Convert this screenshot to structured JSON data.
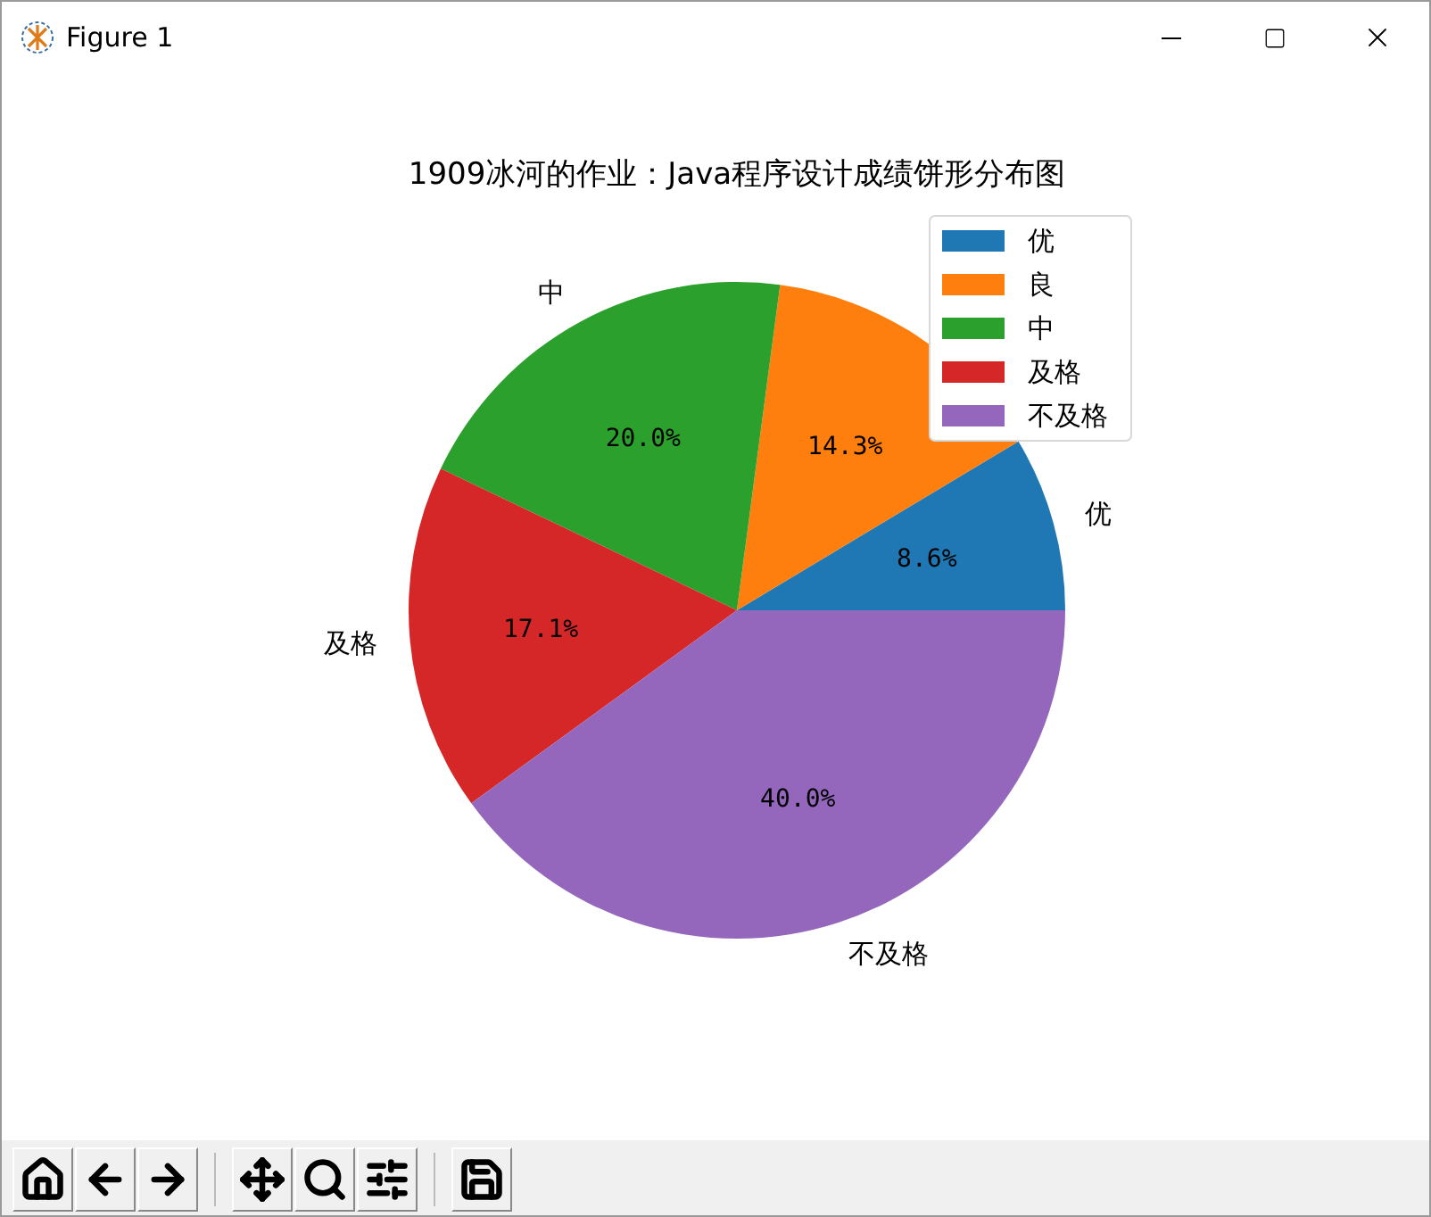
{
  "window": {
    "title": "Figure 1"
  },
  "figure": {
    "chart_data": {
      "type": "pie",
      "title": "1909冰河的作业：Java程序设计成绩饼形分布图",
      "categories": [
        "优",
        "良",
        "中",
        "及格",
        "不及格"
      ],
      "series": [
        {
          "values": [
            8.6,
            14.3,
            20.0,
            17.1,
            40.0
          ]
        }
      ],
      "colors": [
        "#1f77b4",
        "#ff7f0e",
        "#2ca02c",
        "#d62728",
        "#9467bd"
      ],
      "value_labels": [
        "8.6%",
        "14.3%",
        "20.0%",
        "17.1%",
        "40.0%"
      ],
      "legend": true
    }
  },
  "toolbar": [
    {
      "kind": "home"
    },
    {
      "kind": "back"
    },
    {
      "kind": "forward"
    },
    {
      "kind": "separator"
    },
    {
      "kind": "pan"
    },
    {
      "kind": "zoom"
    },
    {
      "kind": "subplots"
    },
    {
      "kind": "separator"
    },
    {
      "kind": "save"
    }
  ]
}
